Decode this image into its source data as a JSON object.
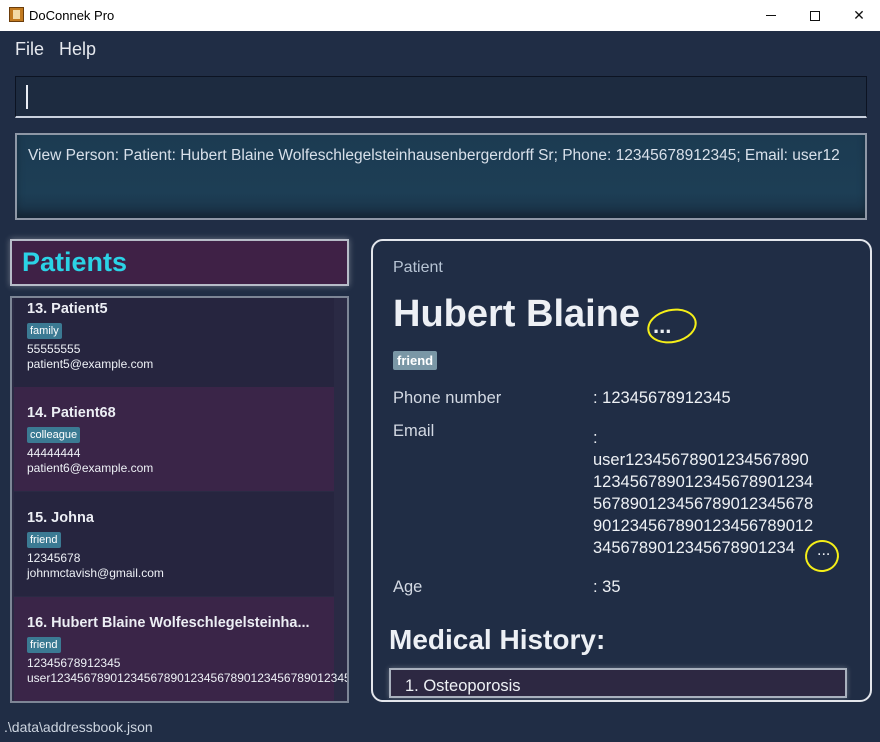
{
  "window": {
    "title": "DoConnek Pro"
  },
  "menu": {
    "file": "File",
    "help": "Help"
  },
  "command_box": {
    "value": ""
  },
  "result_display": {
    "text": "View Person: Patient: Hubert Blaine Wolfeschlegelsteinhausenbergerdorff Sr; Phone: 12345678912345; Email: user12"
  },
  "patients_panel": {
    "title": "Patients",
    "items": [
      {
        "label": "13.  Patient5",
        "tag": "family",
        "phone": "55555555",
        "email": "patient5@example.com"
      },
      {
        "label": "14.  Patient68",
        "tag": "colleague",
        "phone": "44444444",
        "email": "patient6@example.com"
      },
      {
        "label": "15.  Johna",
        "tag": "friend",
        "phone": "12345678",
        "email": "johnmctavish@gmail.com"
      },
      {
        "label": "16.  Hubert Blaine Wolfeschlegelsteinha...",
        "tag": "friend",
        "phone": "12345678912345",
        "email": "user1234567890123456789012345678901234567890123456789012345678..."
      }
    ]
  },
  "detail": {
    "header": "Patient",
    "name": "Hubert Blaine",
    "name_ellipsis": "...",
    "tag": "friend",
    "phone_label": "Phone number",
    "phone_value": ": 12345678912345",
    "email_label": "Email",
    "email_colon": ":",
    "email_lines": [
      "user12345678901234567890",
      "123456789012345678901234",
      "567890123456789012345678",
      "901234567890123456789012",
      "3456789012345678901234"
    ],
    "email_ellipsis": "...",
    "age_label": "Age",
    "age_value": ": 35",
    "medical_history_title": "Medical History:",
    "medical_history": [
      "1.  Osteoporosis"
    ]
  },
  "status_bar": {
    "path": ".\\data\\addressbook.json"
  },
  "colors": {
    "background": "#202d45",
    "patients_title": "#2bd3e6",
    "tag": "#3b7a93",
    "annotation": "#f5ef18"
  }
}
